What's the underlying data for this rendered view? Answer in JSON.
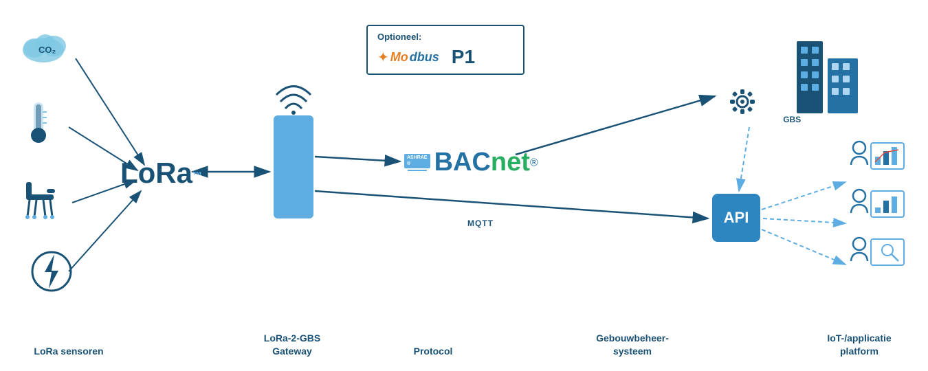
{
  "labels": {
    "lora_sensoren": "LoRa sensoren",
    "lora_gateway": "LoRa-2-GBS\nGateway",
    "protocol": "Protocol",
    "gebouwbeheer": "Gebouwbeheer-\nsysteem",
    "iot_platform": "IoT-/applicatie\nplatform"
  },
  "optional_box": {
    "title": "Optioneel:",
    "modbus": "Modbus",
    "p1": "P1"
  },
  "bacnet": "BACnet",
  "mqtt": "MQTT",
  "api": "API",
  "gbs": "GBS",
  "lora_brand": "LoRa",
  "co2": "CO₂"
}
